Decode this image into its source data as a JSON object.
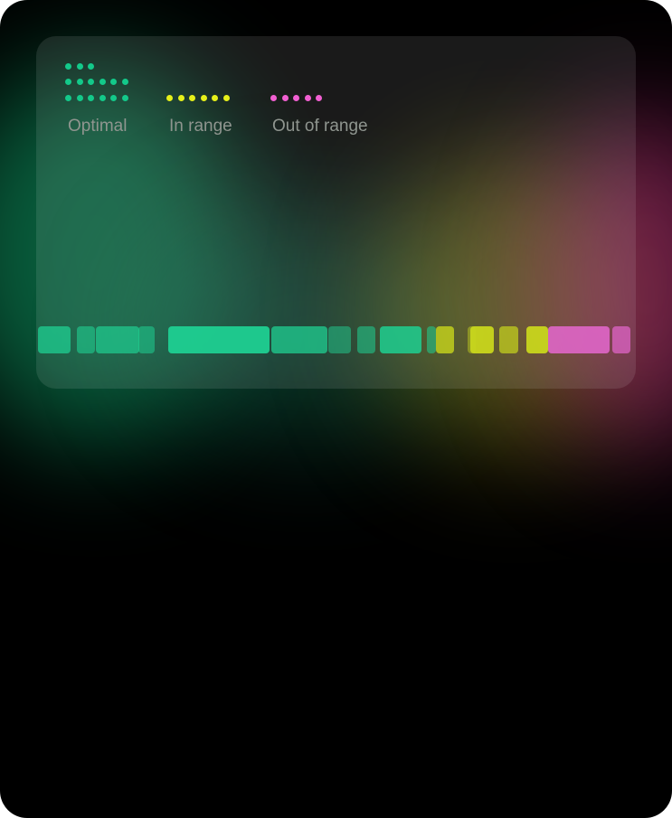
{
  "legend": [
    {
      "label": "Optimal",
      "color": "#13c98a"
    },
    {
      "label": "In range",
      "color": "#e6f01a"
    },
    {
      "label": "Out of range",
      "color": "#f15fd1"
    }
  ],
  "colors": {
    "optimal": "#1fcf91",
    "in_range": "#c8d61c",
    "out_of_range": "#e567cf"
  }
}
